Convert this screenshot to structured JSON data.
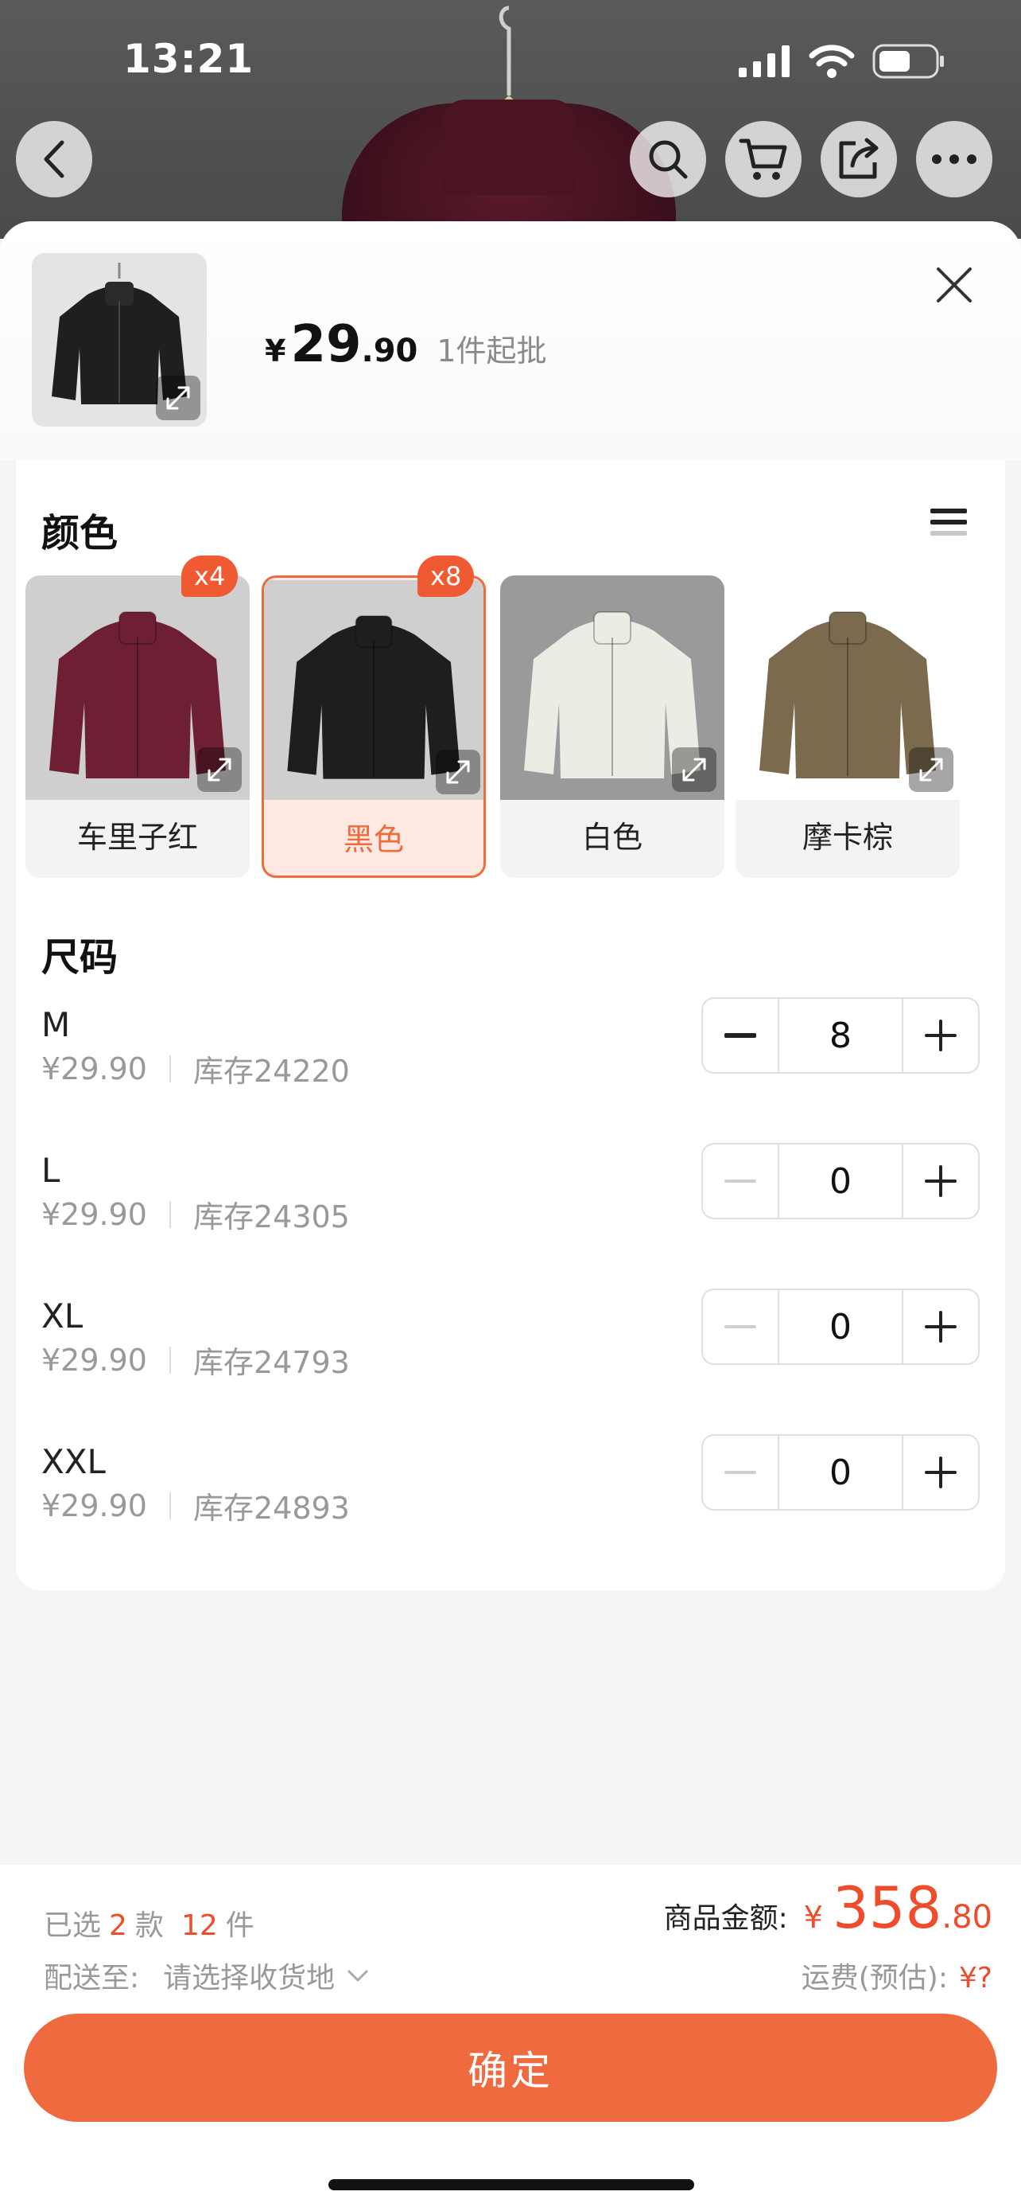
{
  "status_bar": {
    "time": "13:21"
  },
  "header": {
    "price_symbol": "¥",
    "price_int": "29",
    "price_dec": ".90",
    "moq": "1件起批"
  },
  "colors": {
    "title": "颜色",
    "items": [
      {
        "label": "车里子红",
        "badge": "x4",
        "selected": false,
        "swatch": "#6e1f33"
      },
      {
        "label": "黑色",
        "badge": "x8",
        "selected": true,
        "swatch": "#1e1e1e"
      },
      {
        "label": "白色",
        "badge": "",
        "selected": false,
        "swatch": "#ecebe4"
      },
      {
        "label": "摩卡棕",
        "badge": "",
        "selected": false,
        "swatch": "#7b6a4e"
      }
    ]
  },
  "sizes": {
    "title": "尺码",
    "items": [
      {
        "name": "M",
        "price": "¥29.90",
        "stock": "库存24220",
        "qty": "8"
      },
      {
        "name": "L",
        "price": "¥29.90",
        "stock": "库存24305",
        "qty": "0"
      },
      {
        "name": "XL",
        "price": "¥29.90",
        "stock": "库存24793",
        "qty": "0"
      },
      {
        "name": "XXL",
        "price": "¥29.90",
        "stock": "库存24893",
        "qty": "0"
      }
    ]
  },
  "footer": {
    "selected_prefix": "已选",
    "selected_styles": "2",
    "styles_unit": "款",
    "selected_count": "12",
    "count_unit": "件",
    "ship_label": "配送至:",
    "ship_value": "请选择收货地",
    "total_label": "商品金额:",
    "total_symbol": "¥",
    "total_int": "358",
    "total_dec": ".80",
    "freight_label": "运费(预估):",
    "freight_value": "¥?",
    "confirm_label": "确定"
  },
  "accent": "#ef6b3c"
}
